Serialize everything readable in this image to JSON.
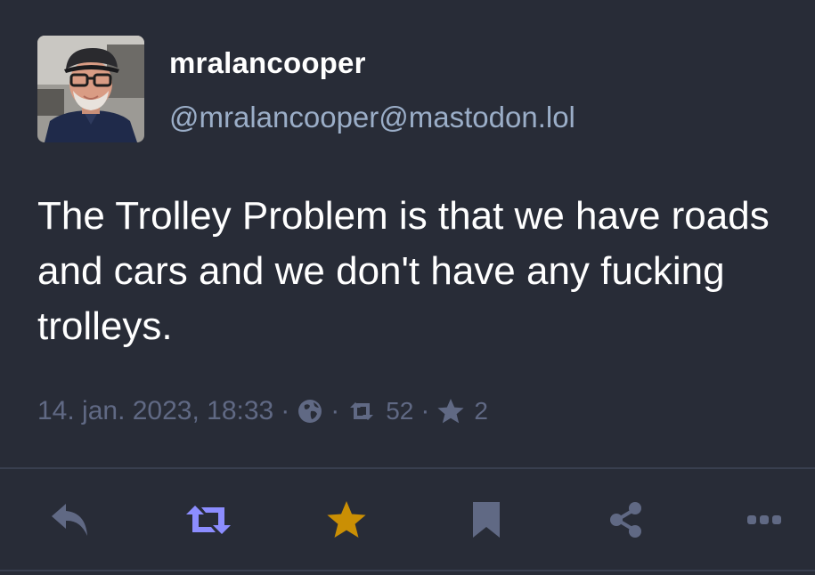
{
  "author": {
    "display_name": "mralancooper",
    "handle": "@mralancooper@mastodon.lol"
  },
  "post": {
    "content": "The Trolley Problem is that we have roads and cars and we don't have any fucking trolleys.",
    "timestamp": "14. jan. 2023, 18:33",
    "visibility_icon": "globe-icon",
    "reblogs_count": "52",
    "favourites_count": "2",
    "separator": "·"
  },
  "actions": [
    {
      "name": "reply",
      "icon": "reply-icon",
      "color": "#606984"
    },
    {
      "name": "boost",
      "icon": "retweet-icon",
      "color": "#8c8dff"
    },
    {
      "name": "favourite",
      "icon": "star-icon",
      "color": "#ca8f04"
    },
    {
      "name": "bookmark",
      "icon": "bookmark-icon",
      "color": "#606984"
    },
    {
      "name": "share",
      "icon": "share-icon",
      "color": "#606984"
    },
    {
      "name": "more",
      "icon": "more-icon",
      "color": "#606984"
    }
  ],
  "colors": {
    "background": "#282c37",
    "text": "#ffffff",
    "handle": "#9baec8",
    "muted": "#606984",
    "boosted": "#8c8dff",
    "favourited": "#ca8f04"
  }
}
